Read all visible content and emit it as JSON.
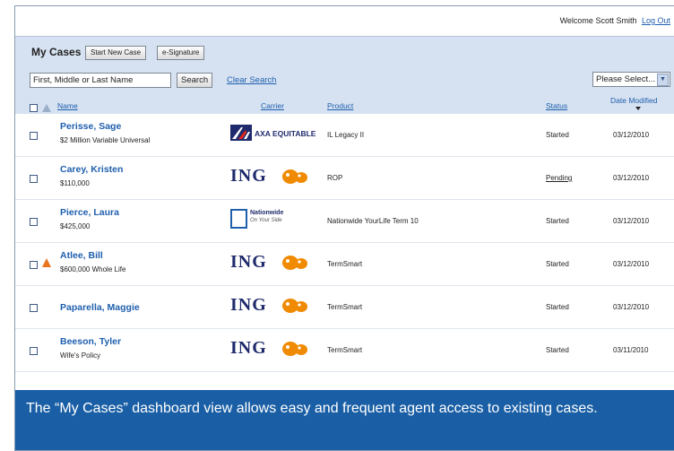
{
  "header": {
    "welcome_text": "Welcome",
    "user_name": "Scott Smith",
    "logout_label": "Log Out"
  },
  "toolbar": {
    "title": "My Cases",
    "start_new_case_label": "Start New Case",
    "esignature_label": "e-Signature",
    "search_value": "First, Middle or Last Name",
    "search_button_label": "Search",
    "clear_search_label": "Clear Search",
    "select_value": "Please Select..."
  },
  "columns": {
    "name": "Name",
    "carrier": "Carrier",
    "product": "Product",
    "status": "Status",
    "date": "Date Modified"
  },
  "cases": [
    {
      "name": "Perisse, Sage",
      "detail": "$2 Million Variable Universal",
      "carrier": "AXA EQUITABLE",
      "product": "IL Legacy II",
      "status": "Started",
      "date": "03/12/2010",
      "warning": false
    },
    {
      "name": "Carey, Kristen",
      "detail": "$110,000",
      "carrier": "ING",
      "product": "ROP",
      "status": "Pending",
      "date": "03/12/2010",
      "warning": false
    },
    {
      "name": "Pierce, Laura",
      "detail": "$425,000",
      "carrier": "Nationwide",
      "carrier_tagline": "On Your Side",
      "product": "Nationwide YourLife Term 10",
      "status": "Started",
      "date": "03/12/2010",
      "warning": false
    },
    {
      "name": "Atlee, Bill",
      "detail": "$600,000 Whole Life",
      "carrier": "ING",
      "product": "TermSmart",
      "status": "Started",
      "date": "03/12/2010",
      "warning": true
    },
    {
      "name": "Paparella, Maggie",
      "detail": "",
      "carrier": "ING",
      "product": "TermSmart",
      "status": "Started",
      "date": "03/12/2010",
      "warning": false
    },
    {
      "name": "Beeson, Tyler",
      "detail": "Wife's Policy",
      "carrier": "ING",
      "product": "TermSmart",
      "status": "Started",
      "date": "03/11/2010",
      "warning": false
    }
  ],
  "caption": "The “My Cases” dashboard view allows easy and frequent agent access to existing cases.",
  "colors": {
    "accent": "#1f5fae",
    "toolbar_bg": "#d6e2f1",
    "caption_bg": "#1a5fa5",
    "ing_orange": "#f08a00",
    "warning_orange": "#e8741c"
  }
}
